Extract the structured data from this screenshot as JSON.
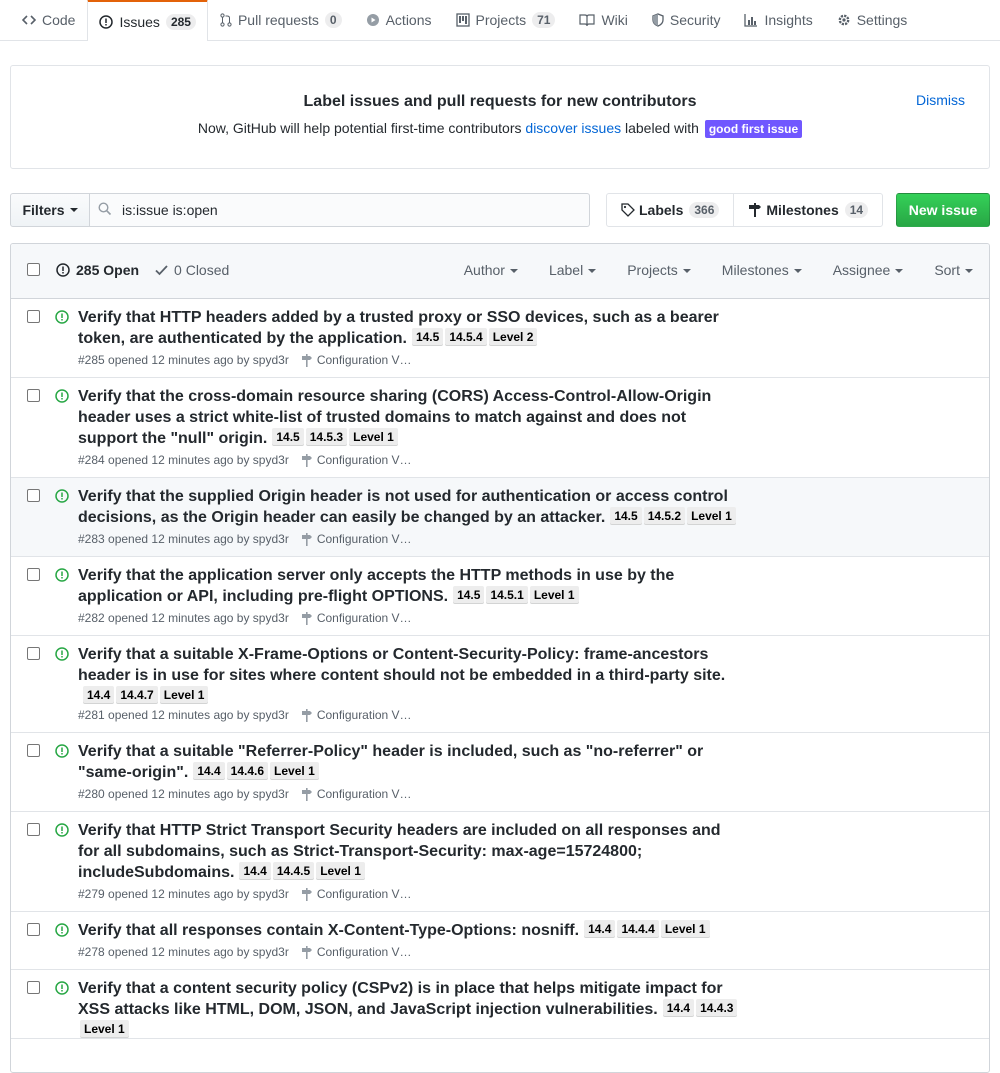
{
  "nav": {
    "tabs": [
      {
        "label": "Code",
        "count": ""
      },
      {
        "label": "Issues",
        "count": "285"
      },
      {
        "label": "Pull requests",
        "count": "0"
      },
      {
        "label": "Actions",
        "count": ""
      },
      {
        "label": "Projects",
        "count": "71"
      },
      {
        "label": "Wiki",
        "count": ""
      },
      {
        "label": "Security",
        "count": ""
      },
      {
        "label": "Insights",
        "count": ""
      },
      {
        "label": "Settings",
        "count": ""
      }
    ]
  },
  "banner": {
    "title": "Label issues and pull requests for new contributors",
    "text_before": "Now, GitHub will help potential first-time contributors ",
    "link": "discover issues",
    "text_after": " labeled with ",
    "label": "good first issue",
    "dismiss": "Dismiss"
  },
  "subnav": {
    "filters": "Filters",
    "search_value": "is:issue is:open",
    "labels": "Labels",
    "labels_count": "366",
    "milestones": "Milestones",
    "milestones_count": "14",
    "new_issue": "New issue"
  },
  "list_header": {
    "open": "285 Open",
    "closed": "0 Closed",
    "filters": [
      "Author",
      "Label",
      "Projects",
      "Milestones",
      "Assignee",
      "Sort"
    ]
  },
  "issues": [
    {
      "title": "Verify that HTTP headers added by a trusted proxy or SSO devices, such as a bearer token, are authenticated by the application.",
      "labels": [
        "14.5",
        "14.5.4",
        "Level 2"
      ],
      "meta": "#285 opened 12 minutes ago by spyd3r",
      "milestone": "Configuration V…"
    },
    {
      "title": "Verify that the cross-domain resource sharing (CORS) Access-Control-Allow-Origin header uses a strict white-list of trusted domains to match against and does not support the \"null\" origin.",
      "labels": [
        "14.5",
        "14.5.3",
        "Level 1"
      ],
      "meta": "#284 opened 12 minutes ago by spyd3r",
      "milestone": "Configuration V…"
    },
    {
      "title": "Verify that the supplied Origin header is not used for authentication or access control decisions, as the Origin header can easily be changed by an attacker.",
      "labels": [
        "14.5",
        "14.5.2",
        "Level 1"
      ],
      "meta": "#283 opened 12 minutes ago by spyd3r",
      "milestone": "Configuration V…"
    },
    {
      "title": "Verify that the application server only accepts the HTTP methods in use by the application or API, including pre-flight OPTIONS.",
      "labels": [
        "14.5",
        "14.5.1",
        "Level 1"
      ],
      "meta": "#282 opened 12 minutes ago by spyd3r",
      "milestone": "Configuration V…"
    },
    {
      "title": "Verify that a suitable X-Frame-Options or Content-Security-Policy: frame-ancestors header is in use for sites where content should not be embedded in a third-party site.",
      "labels": [
        "14.4",
        "14.4.7",
        "Level 1"
      ],
      "meta": "#281 opened 12 minutes ago by spyd3r",
      "milestone": "Configuration V…"
    },
    {
      "title": "Verify that a suitable \"Referrer-Policy\" header is included, such as \"no-referrer\" or \"same-origin\".",
      "labels": [
        "14.4",
        "14.4.6",
        "Level 1"
      ],
      "meta": "#280 opened 12 minutes ago by spyd3r",
      "milestone": "Configuration V…"
    },
    {
      "title": "Verify that HTTP Strict Transport Security headers are included on all responses and for all subdomains, such as Strict-Transport-Security: max-age=15724800; includeSubdomains.",
      "labels": [
        "14.4",
        "14.4.5",
        "Level 1"
      ],
      "meta": "#279 opened 12 minutes ago by spyd3r",
      "milestone": "Configuration V…"
    },
    {
      "title": "Verify that all responses contain X-Content-Type-Options: nosniff.",
      "labels": [
        "14.4",
        "14.4.4",
        "Level 1"
      ],
      "meta": "#278 opened 12 minutes ago by spyd3r",
      "milestone": "Configuration V…"
    },
    {
      "title": "Verify that a content security policy (CSPv2) is in place that helps mitigate impact for XSS attacks like HTML, DOM, JSON, and JavaScript injection vulnerabilities.",
      "labels": [
        "14.4",
        "14.4.3",
        "Level 1"
      ],
      "meta": "",
      "milestone": ""
    }
  ]
}
